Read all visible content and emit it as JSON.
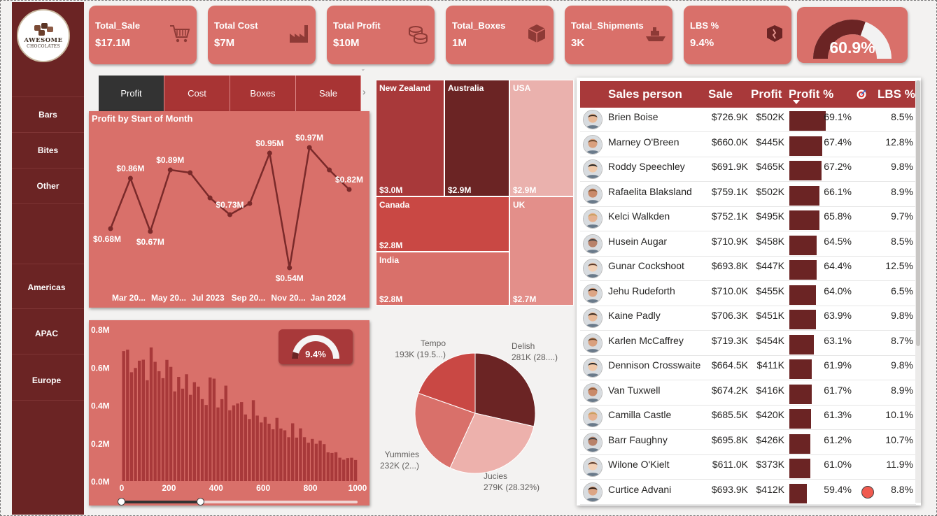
{
  "logo": {
    "title": "AWESOME",
    "subtitle": "CHOCOLATES"
  },
  "nav": {
    "products": [
      "Bars",
      "Bites",
      "Other"
    ],
    "regions": [
      "Americas",
      "APAC",
      "Europe"
    ]
  },
  "kpis": [
    {
      "title": "Total_Sale",
      "value": "$17.1M",
      "icon": "shopping-cart-icon"
    },
    {
      "title": "Total Cost",
      "value": "$7M",
      "icon": "factory-icon"
    },
    {
      "title": "Total Profit",
      "value": "$10M",
      "icon": "coins-icon"
    },
    {
      "title": "Total_Boxes",
      "value": "1M",
      "icon": "box-icon"
    },
    {
      "title": "Total_Shipments",
      "value": "3K",
      "icon": "ship-icon"
    },
    {
      "title": "LBS %",
      "value": "9.4%",
      "icon": "broken-box-icon"
    }
  ],
  "gauge_top": {
    "value": "60.9%",
    "fraction": 0.609
  },
  "tabs": [
    "Profit",
    "Cost",
    "Boxes",
    "Sale"
  ],
  "colors": {
    "primary": "#d9706a",
    "dark": "#6b2424",
    "accent": "#a8393a",
    "sidebar": "#6b2424"
  },
  "line_chart": {
    "title": "Profit by Start of Month",
    "x_ticks": [
      "Mar 20...",
      "May 20...",
      "Jul 2023",
      "Sep 20...",
      "Nov 20...",
      "Jan 2024"
    ],
    "points": [
      {
        "label": "$0.68M",
        "value": 0.68
      },
      {
        "label": "$0.86M",
        "value": 0.86
      },
      {
        "label": "$0.67M",
        "value": 0.67
      },
      {
        "label": "$0.89M",
        "value": 0.89
      },
      {
        "label": "",
        "value": 0.88
      },
      {
        "label": "",
        "value": 0.79
      },
      {
        "label": "$0.73M",
        "value": 0.73
      },
      {
        "label": "",
        "value": 0.77
      },
      {
        "label": "$0.95M",
        "value": 0.95
      },
      {
        "label": "$0.54M",
        "value": 0.54
      },
      {
        "label": "$0.97M",
        "value": 0.97
      },
      {
        "label": "",
        "value": 0.89
      },
      {
        "label": "$0.82M",
        "value": 0.82
      }
    ]
  },
  "treemap": [
    {
      "name": "New Zealand",
      "value": "$3.0M"
    },
    {
      "name": "Australia",
      "value": "$2.9M"
    },
    {
      "name": "USA",
      "value": "$2.9M"
    },
    {
      "name": "Canada",
      "value": "$2.8M"
    },
    {
      "name": "UK",
      "value": "$2.7M"
    },
    {
      "name": "India",
      "value": "$2.8M"
    }
  ],
  "histogram": {
    "y_ticks": [
      "0.8M",
      "0.6M",
      "0.4M",
      "0.2M",
      "0.0M"
    ],
    "x_ticks": [
      "0",
      "200",
      "400",
      "600",
      "800",
      "1000"
    ],
    "gauge_value": "9.4%",
    "gauge_fraction": 0.094
  },
  "pie": {
    "slices": [
      {
        "name": "Delish",
        "detail": "281K (28....)",
        "value": 281,
        "color": "#6b2424"
      },
      {
        "name": "Jucies",
        "detail": "279K (28.32%)",
        "value": 279,
        "color": "#edb1ac"
      },
      {
        "name": "Yummies",
        "detail": "232K (2...)",
        "value": 232,
        "color": "#d9706a"
      },
      {
        "name": "Tempo",
        "detail": "193K (19.5...)",
        "value": 193,
        "color": "#c94844"
      }
    ]
  },
  "table": {
    "headers": {
      "person": "Sales person",
      "sale": "Sale",
      "profit": "Profit",
      "profit_pct": "Profit %",
      "lbs": "LBS %"
    },
    "rows": [
      {
        "name": "Brien Boise",
        "sale": "$726.9K",
        "profit": "$502K",
        "pct": "69.1%",
        "pct_value": 69.1,
        "lbs": "8.5%"
      },
      {
        "name": "Marney O'Breen",
        "sale": "$660.0K",
        "profit": "$445K",
        "pct": "67.4%",
        "pct_value": 67.4,
        "lbs": "12.8%"
      },
      {
        "name": "Roddy Speechley",
        "sale": "$691.9K",
        "profit": "$465K",
        "pct": "67.2%",
        "pct_value": 67.2,
        "lbs": "9.8%"
      },
      {
        "name": "Rafaelita Blaksland",
        "sale": "$759.1K",
        "profit": "$502K",
        "pct": "66.1%",
        "pct_value": 66.1,
        "lbs": "8.9%"
      },
      {
        "name": "Kelci Walkden",
        "sale": "$752.1K",
        "profit": "$495K",
        "pct": "65.8%",
        "pct_value": 65.8,
        "lbs": "9.7%"
      },
      {
        "name": "Husein Augar",
        "sale": "$710.9K",
        "profit": "$458K",
        "pct": "64.5%",
        "pct_value": 64.5,
        "lbs": "8.5%"
      },
      {
        "name": "Gunar Cockshoot",
        "sale": "$693.8K",
        "profit": "$447K",
        "pct": "64.4%",
        "pct_value": 64.4,
        "lbs": "12.5%"
      },
      {
        "name": "Jehu Rudeforth",
        "sale": "$710.0K",
        "profit": "$455K",
        "pct": "64.0%",
        "pct_value": 64.0,
        "lbs": "6.5%"
      },
      {
        "name": "Kaine Padly",
        "sale": "$706.3K",
        "profit": "$451K",
        "pct": "63.9%",
        "pct_value": 63.9,
        "lbs": "9.8%"
      },
      {
        "name": "Karlen McCaffrey",
        "sale": "$719.3K",
        "profit": "$454K",
        "pct": "63.1%",
        "pct_value": 63.1,
        "lbs": "8.7%"
      },
      {
        "name": "Dennison Crosswaite",
        "sale": "$664.5K",
        "profit": "$411K",
        "pct": "61.9%",
        "pct_value": 61.9,
        "lbs": "9.8%"
      },
      {
        "name": "Van Tuxwell",
        "sale": "$674.2K",
        "profit": "$416K",
        "pct": "61.7%",
        "pct_value": 61.7,
        "lbs": "8.9%"
      },
      {
        "name": "Camilla Castle",
        "sale": "$685.5K",
        "profit": "$420K",
        "pct": "61.3%",
        "pct_value": 61.3,
        "lbs": "10.1%"
      },
      {
        "name": "Barr Faughny",
        "sale": "$695.8K",
        "profit": "$426K",
        "pct": "61.2%",
        "pct_value": 61.2,
        "lbs": "10.7%"
      },
      {
        "name": "Wilone O'Kielt",
        "sale": "$611.0K",
        "profit": "$373K",
        "pct": "61.0%",
        "pct_value": 61.0,
        "lbs": "11.9%"
      },
      {
        "name": "Curtice Advani",
        "sale": "$693.9K",
        "profit": "$412K",
        "pct": "59.4%",
        "pct_value": 59.4,
        "lbs": "8.8%",
        "flag": true
      }
    ]
  }
}
